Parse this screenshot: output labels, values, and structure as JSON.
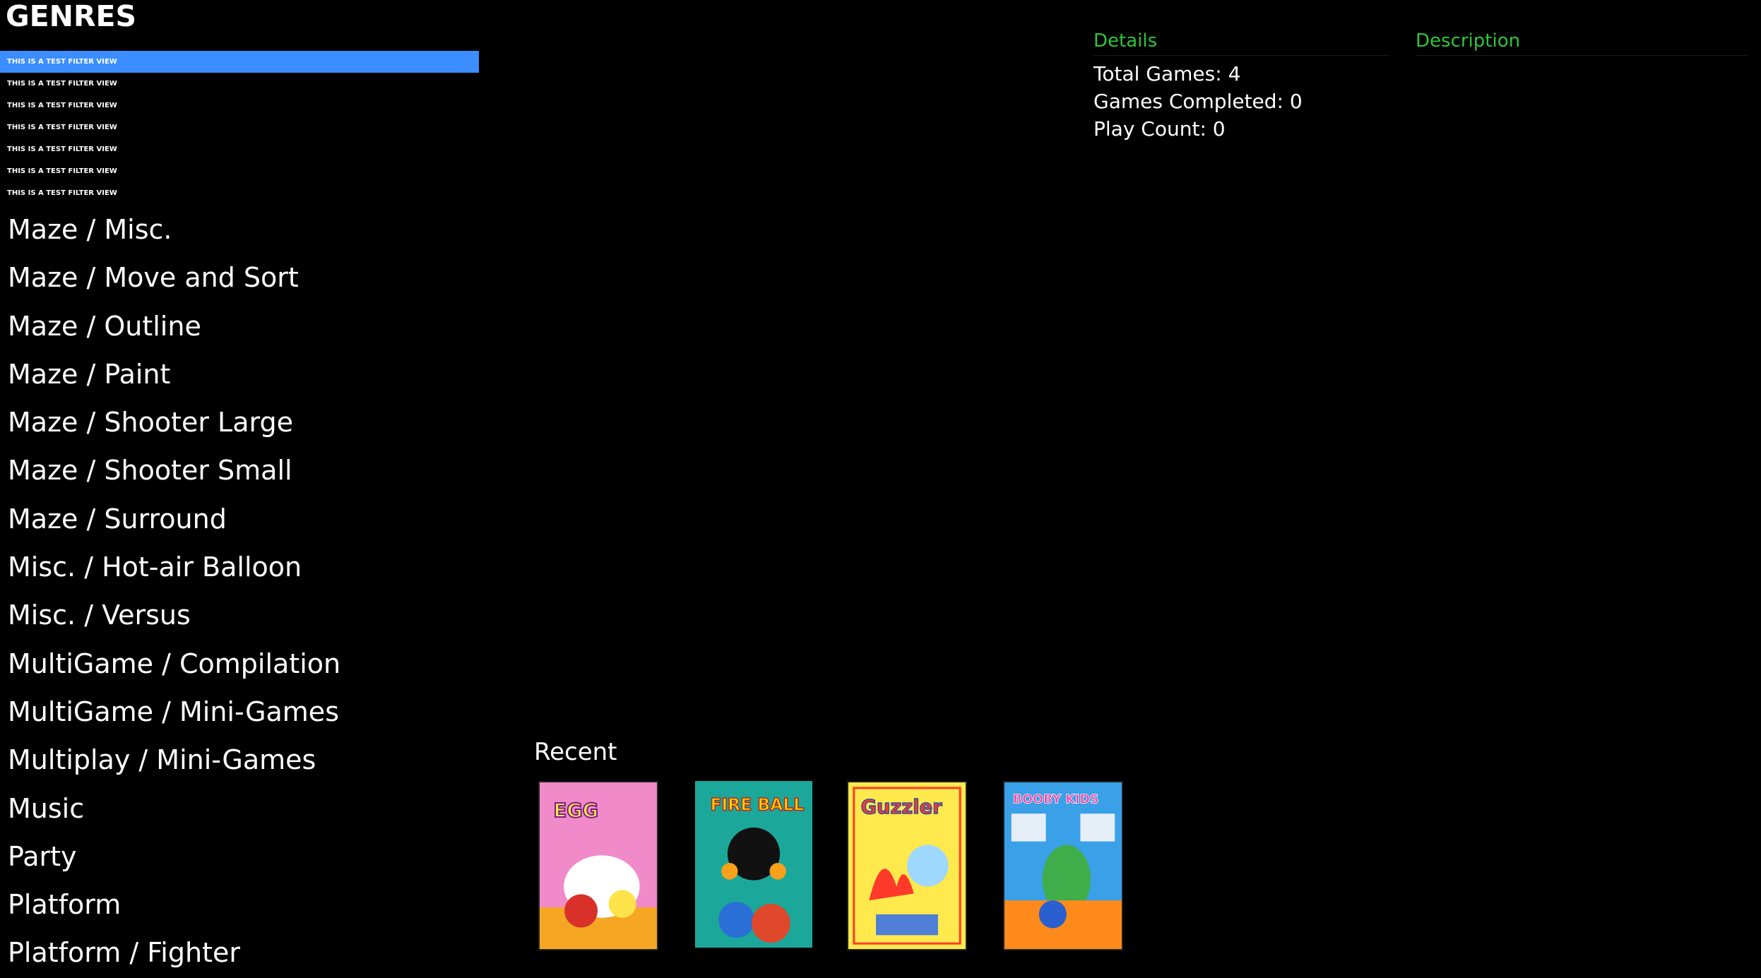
{
  "header": {
    "title": "GENRES"
  },
  "filters": [
    {
      "label": "THIS IS A TEST FILTER VIEW",
      "selected": true
    },
    {
      "label": "THIS IS A TEST FILTER VIEW",
      "selected": false
    },
    {
      "label": "THIS IS A TEST FILTER VIEW",
      "selected": false
    },
    {
      "label": "THIS IS A TEST FILTER VIEW",
      "selected": false
    },
    {
      "label": "THIS IS A TEST FILTER VIEW",
      "selected": false
    },
    {
      "label": "THIS IS A TEST FILTER VIEW",
      "selected": false
    },
    {
      "label": "THIS IS A TEST FILTER VIEW",
      "selected": false
    }
  ],
  "genres": [
    "Maze / Misc.",
    "Maze / Move and Sort",
    "Maze / Outline",
    "Maze / Paint",
    "Maze / Shooter Large",
    "Maze / Shooter Small",
    "Maze / Surround",
    "Misc. / Hot-air Balloon",
    "Misc. / Versus",
    "MultiGame / Compilation",
    "MultiGame / Mini-Games",
    "Multiplay / Mini-Games",
    "Music",
    "Party",
    "Platform",
    "Platform / Fighter"
  ],
  "details": {
    "heading": "Details",
    "total_games": "Total Games: 4",
    "games_completed": "Games Completed: 0",
    "play_count": "Play Count: 0"
  },
  "description": {
    "heading": "Description"
  },
  "recent": {
    "label": "Recent",
    "covers": [
      {
        "name": "eggmania-cover",
        "bg": "#f08ac8",
        "accent": "#f5a623",
        "text": "EGG"
      },
      {
        "name": "fireball-cover",
        "bg": "#1ba89a",
        "accent": "#ffd800",
        "text": "FIRE BALL"
      },
      {
        "name": "guzzler-cover",
        "bg": "#ffe94d",
        "accent": "#ff3a2a",
        "text": "Guzzler"
      },
      {
        "name": "boobykids-cover",
        "bg": "#3aa0e8",
        "accent": "#ff8a1c",
        "text": "BOOBY KIDS"
      }
    ]
  },
  "colors": {
    "background": "#000000",
    "selection": "#3c8dff",
    "section_heading": "#2fc43a",
    "text": "#ffffff"
  }
}
